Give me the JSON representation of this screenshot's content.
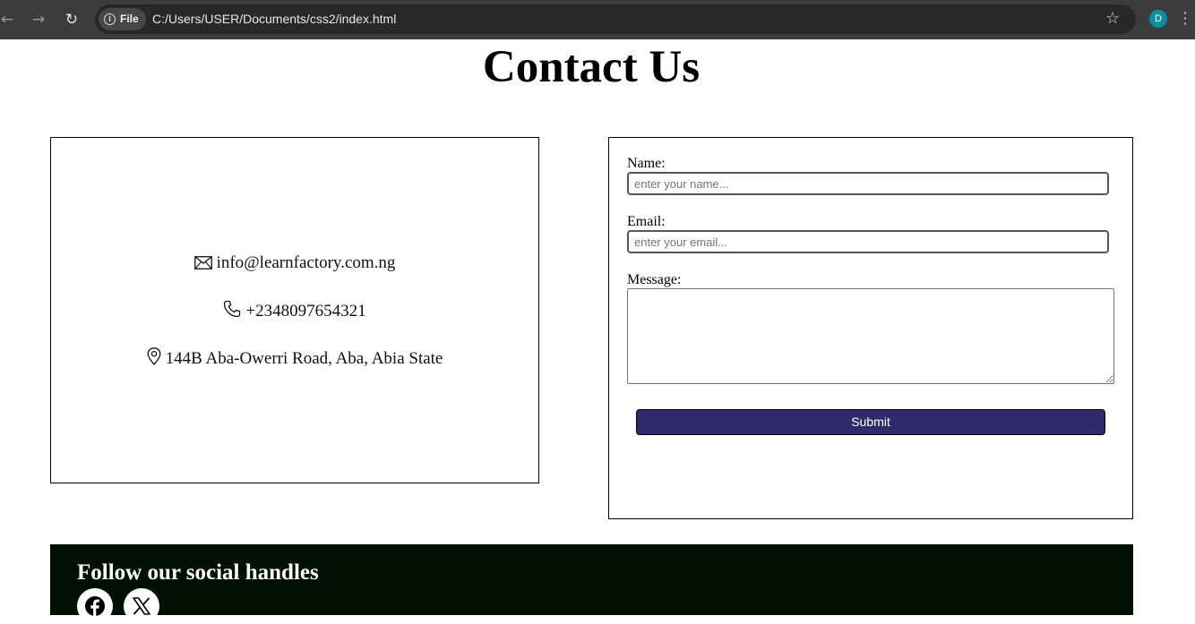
{
  "browser": {
    "file_chip_label": "File",
    "url": "C:/Users/USER/Documents/css2/index.html",
    "profile_initial": "D",
    "profile_color": "#0b8fa0"
  },
  "page": {
    "title": "Contact Us"
  },
  "contact": {
    "email": "info@learnfactory.com.ng",
    "phone": "+2348097654321",
    "address": "144B Aba-Owerri Road, Aba, Abia State"
  },
  "form": {
    "name_label": "Name:",
    "name_placeholder": "enter your name...",
    "email_label": "Email:",
    "email_placeholder": "enter your email...",
    "message_label": "Message:",
    "submit_label": "Submit",
    "submit_color": "#2e2a6b"
  },
  "footer": {
    "heading": "Follow our social handles",
    "background": "#021002",
    "socials": [
      {
        "icon": "facebook-icon"
      },
      {
        "icon": "x-icon"
      }
    ]
  }
}
